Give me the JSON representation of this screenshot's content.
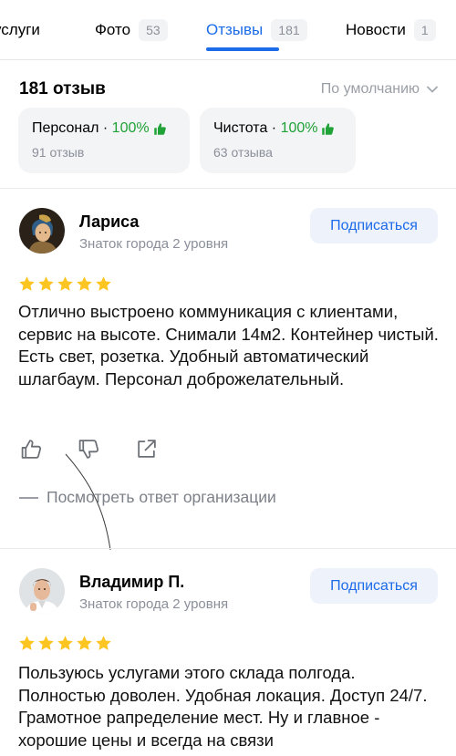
{
  "tabs": [
    {
      "label": "услуги",
      "count": ""
    },
    {
      "label": "Фото",
      "count": "53"
    },
    {
      "label": "Отзывы",
      "count": "181"
    },
    {
      "label": "Новости",
      "count": "1"
    }
  ],
  "summary": {
    "count_label": "181 отзыв",
    "sort_label": "По умолчанию"
  },
  "aspects": [
    {
      "name": "Персонал",
      "separator": " · ",
      "percent": "100%",
      "reviews": "91 отзыв"
    },
    {
      "name": "Чистота",
      "separator": " · ",
      "percent": "100%",
      "reviews": "63 отзыва"
    }
  ],
  "reviews": [
    {
      "author": "Лариса",
      "level": "Знаток города 2 уровня",
      "subscribe_label": "Подписаться",
      "rating": 5,
      "text": "Отлично выстроено коммуникация с клиентами, сервис на высоте. Снимали 14м2. Контейнер чистый. Есть свет, розетка. Удобный автоматический шлагбаум. Персонал доброжелательный.",
      "org_reply_label": "Посмотреть ответ организации"
    },
    {
      "author": "Владимир П.",
      "level": "Знаток города 2 уровня",
      "subscribe_label": "Подписаться",
      "rating": 5,
      "text": "Пользуюсь услугами этого склада полгода. Полностью доволен. Удобная локация. Доступ 24/7. Грамотное рапределение мест. Ну и главное - хорошие цены и всегда на связи"
    }
  ],
  "colors": {
    "accent": "#1c6be8",
    "positive": "#1fa236",
    "star": "#fcc521"
  },
  "icons": {
    "like": "thumb-up-icon",
    "dislike": "thumb-down-icon",
    "share": "share-icon",
    "sort": "chevron-down-icon"
  }
}
